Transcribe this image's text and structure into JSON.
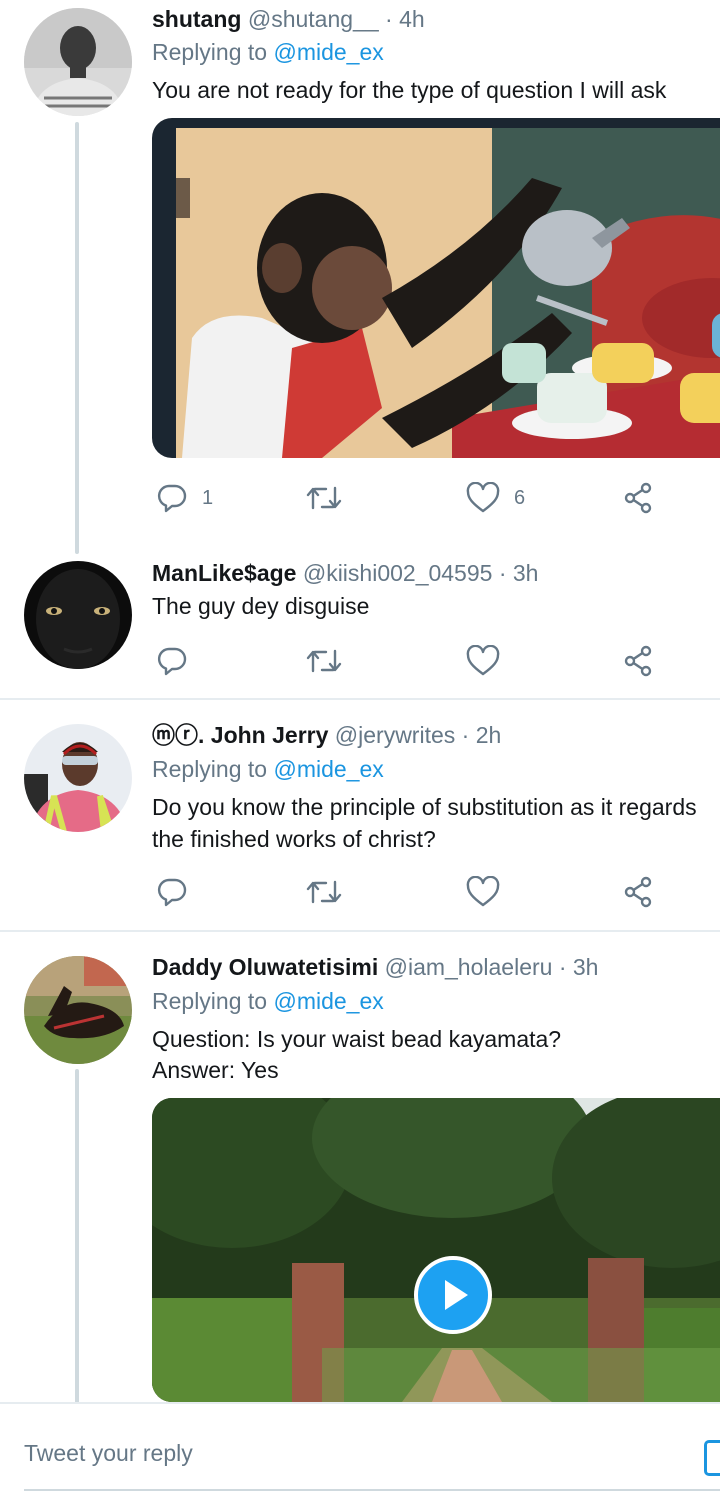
{
  "tweets": [
    {
      "name": "shutang",
      "handle": "@shutang__",
      "time": "4h",
      "replying_prefix": "Replying to",
      "replying_to": "@mide_ex",
      "text_lines": [
        "You are not ready for the type of question I will ask"
      ],
      "reply_count": "1",
      "like_count": "6"
    },
    {
      "name": "ManLike$age",
      "handle": "@kiishi002_04595",
      "time": "3h",
      "text_lines": [
        "The guy dey disguise"
      ]
    },
    {
      "name": "ⓜⓡ. John Jerry",
      "handle": "@jerywrites",
      "time": "2h",
      "replying_prefix": "Replying to",
      "replying_to": "@mide_ex",
      "text_lines": [
        "Do you know the principle of substitution as it regards",
        "the finished works of christ?"
      ]
    },
    {
      "name": "Daddy Oluwatetisimi",
      "handle": "@iam_holaeleru",
      "time": "3h",
      "replying_prefix": "Replying to",
      "replying_to": "@mide_ex",
      "text_lines": [
        "Question: Is your waist bead kayamata?",
        "Answer: Yes"
      ]
    }
  ],
  "dot": "·",
  "reply_bar": {
    "placeholder": "Tweet your reply"
  },
  "colors": {
    "accent": "#1b95e0",
    "muted": "#657786",
    "line": "#cfd9de"
  },
  "icons": [
    "reply-icon",
    "retweet-icon",
    "like-icon",
    "share-icon",
    "play-icon"
  ]
}
